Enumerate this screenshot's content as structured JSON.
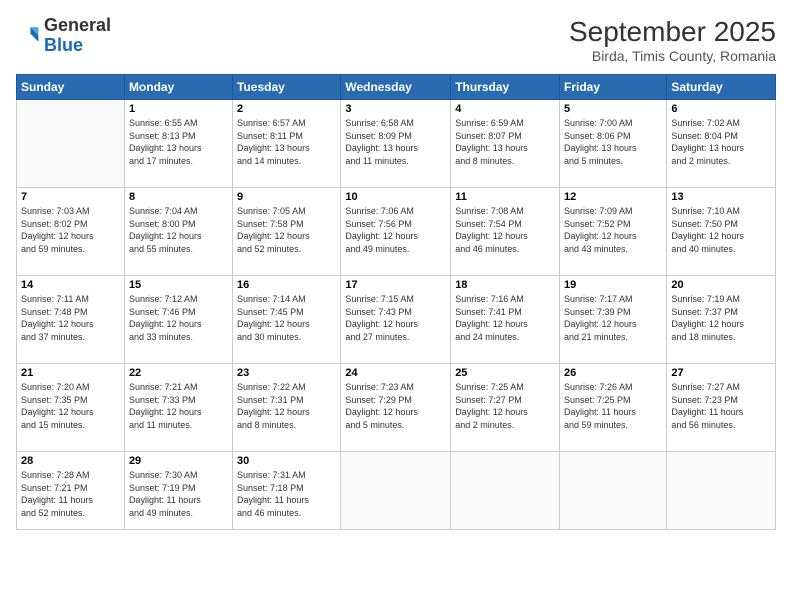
{
  "header": {
    "logo": {
      "general": "General",
      "blue": "Blue"
    },
    "title": "September 2025",
    "subtitle": "Birda, Timis County, Romania"
  },
  "weekdays": [
    "Sunday",
    "Monday",
    "Tuesday",
    "Wednesday",
    "Thursday",
    "Friday",
    "Saturday"
  ],
  "weeks": [
    [
      {
        "day": "",
        "content": ""
      },
      {
        "day": "1",
        "content": "Sunrise: 6:55 AM\nSunset: 8:13 PM\nDaylight: 13 hours\nand 17 minutes."
      },
      {
        "day": "2",
        "content": "Sunrise: 6:57 AM\nSunset: 8:11 PM\nDaylight: 13 hours\nand 14 minutes."
      },
      {
        "day": "3",
        "content": "Sunrise: 6:58 AM\nSunset: 8:09 PM\nDaylight: 13 hours\nand 11 minutes."
      },
      {
        "day": "4",
        "content": "Sunrise: 6:59 AM\nSunset: 8:07 PM\nDaylight: 13 hours\nand 8 minutes."
      },
      {
        "day": "5",
        "content": "Sunrise: 7:00 AM\nSunset: 8:06 PM\nDaylight: 13 hours\nand 5 minutes."
      },
      {
        "day": "6",
        "content": "Sunrise: 7:02 AM\nSunset: 8:04 PM\nDaylight: 13 hours\nand 2 minutes."
      }
    ],
    [
      {
        "day": "7",
        "content": "Sunrise: 7:03 AM\nSunset: 8:02 PM\nDaylight: 12 hours\nand 59 minutes."
      },
      {
        "day": "8",
        "content": "Sunrise: 7:04 AM\nSunset: 8:00 PM\nDaylight: 12 hours\nand 55 minutes."
      },
      {
        "day": "9",
        "content": "Sunrise: 7:05 AM\nSunset: 7:58 PM\nDaylight: 12 hours\nand 52 minutes."
      },
      {
        "day": "10",
        "content": "Sunrise: 7:06 AM\nSunset: 7:56 PM\nDaylight: 12 hours\nand 49 minutes."
      },
      {
        "day": "11",
        "content": "Sunrise: 7:08 AM\nSunset: 7:54 PM\nDaylight: 12 hours\nand 46 minutes."
      },
      {
        "day": "12",
        "content": "Sunrise: 7:09 AM\nSunset: 7:52 PM\nDaylight: 12 hours\nand 43 minutes."
      },
      {
        "day": "13",
        "content": "Sunrise: 7:10 AM\nSunset: 7:50 PM\nDaylight: 12 hours\nand 40 minutes."
      }
    ],
    [
      {
        "day": "14",
        "content": "Sunrise: 7:11 AM\nSunset: 7:48 PM\nDaylight: 12 hours\nand 37 minutes."
      },
      {
        "day": "15",
        "content": "Sunrise: 7:12 AM\nSunset: 7:46 PM\nDaylight: 12 hours\nand 33 minutes."
      },
      {
        "day": "16",
        "content": "Sunrise: 7:14 AM\nSunset: 7:45 PM\nDaylight: 12 hours\nand 30 minutes."
      },
      {
        "day": "17",
        "content": "Sunrise: 7:15 AM\nSunset: 7:43 PM\nDaylight: 12 hours\nand 27 minutes."
      },
      {
        "day": "18",
        "content": "Sunrise: 7:16 AM\nSunset: 7:41 PM\nDaylight: 12 hours\nand 24 minutes."
      },
      {
        "day": "19",
        "content": "Sunrise: 7:17 AM\nSunset: 7:39 PM\nDaylight: 12 hours\nand 21 minutes."
      },
      {
        "day": "20",
        "content": "Sunrise: 7:19 AM\nSunset: 7:37 PM\nDaylight: 12 hours\nand 18 minutes."
      }
    ],
    [
      {
        "day": "21",
        "content": "Sunrise: 7:20 AM\nSunset: 7:35 PM\nDaylight: 12 hours\nand 15 minutes."
      },
      {
        "day": "22",
        "content": "Sunrise: 7:21 AM\nSunset: 7:33 PM\nDaylight: 12 hours\nand 11 minutes."
      },
      {
        "day": "23",
        "content": "Sunrise: 7:22 AM\nSunset: 7:31 PM\nDaylight: 12 hours\nand 8 minutes."
      },
      {
        "day": "24",
        "content": "Sunrise: 7:23 AM\nSunset: 7:29 PM\nDaylight: 12 hours\nand 5 minutes."
      },
      {
        "day": "25",
        "content": "Sunrise: 7:25 AM\nSunset: 7:27 PM\nDaylight: 12 hours\nand 2 minutes."
      },
      {
        "day": "26",
        "content": "Sunrise: 7:26 AM\nSunset: 7:25 PM\nDaylight: 11 hours\nand 59 minutes."
      },
      {
        "day": "27",
        "content": "Sunrise: 7:27 AM\nSunset: 7:23 PM\nDaylight: 11 hours\nand 56 minutes."
      }
    ],
    [
      {
        "day": "28",
        "content": "Sunrise: 7:28 AM\nSunset: 7:21 PM\nDaylight: 11 hours\nand 52 minutes."
      },
      {
        "day": "29",
        "content": "Sunrise: 7:30 AM\nSunset: 7:19 PM\nDaylight: 11 hours\nand 49 minutes."
      },
      {
        "day": "30",
        "content": "Sunrise: 7:31 AM\nSunset: 7:18 PM\nDaylight: 11 hours\nand 46 minutes."
      },
      {
        "day": "",
        "content": ""
      },
      {
        "day": "",
        "content": ""
      },
      {
        "day": "",
        "content": ""
      },
      {
        "day": "",
        "content": ""
      }
    ]
  ]
}
